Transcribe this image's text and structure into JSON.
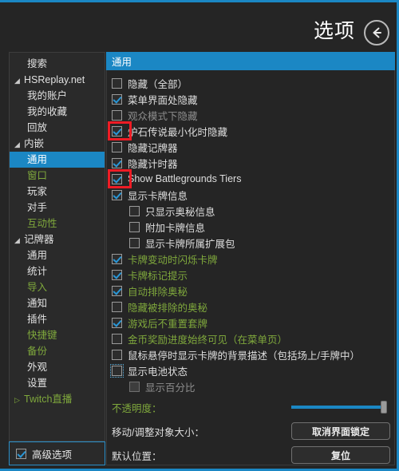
{
  "header": {
    "title": "选项",
    "back_icon": "arrow-left-icon"
  },
  "sidebar": {
    "items": [
      {
        "label": "搜索",
        "level": 1,
        "arrow": "",
        "green": false,
        "selected": false
      },
      {
        "label": "HSReplay.net",
        "level": 0,
        "arrow": "◢",
        "green": false,
        "selected": false
      },
      {
        "label": "我的账户",
        "level": 1,
        "arrow": "",
        "green": false,
        "selected": false
      },
      {
        "label": "我的收藏",
        "level": 1,
        "arrow": "",
        "green": false,
        "selected": false
      },
      {
        "label": "回放",
        "level": 1,
        "arrow": "",
        "green": false,
        "selected": false
      },
      {
        "label": "内嵌",
        "level": 0,
        "arrow": "◢",
        "green": false,
        "selected": false
      },
      {
        "label": "通用",
        "level": 1,
        "arrow": "",
        "green": false,
        "selected": true
      },
      {
        "label": "窗口",
        "level": 1,
        "arrow": "",
        "green": true,
        "selected": false
      },
      {
        "label": "玩家",
        "level": 1,
        "arrow": "",
        "green": false,
        "selected": false
      },
      {
        "label": "对手",
        "level": 1,
        "arrow": "",
        "green": false,
        "selected": false
      },
      {
        "label": "互动性",
        "level": 1,
        "arrow": "",
        "green": true,
        "selected": false
      },
      {
        "label": "记牌器",
        "level": 0,
        "arrow": "◢",
        "green": false,
        "selected": false
      },
      {
        "label": "通用",
        "level": 1,
        "arrow": "",
        "green": false,
        "selected": false
      },
      {
        "label": "统计",
        "level": 1,
        "arrow": "",
        "green": false,
        "selected": false
      },
      {
        "label": "导入",
        "level": 1,
        "arrow": "",
        "green": true,
        "selected": false
      },
      {
        "label": "通知",
        "level": 1,
        "arrow": "",
        "green": false,
        "selected": false
      },
      {
        "label": "插件",
        "level": 1,
        "arrow": "",
        "green": false,
        "selected": false
      },
      {
        "label": "快捷键",
        "level": 1,
        "arrow": "",
        "green": true,
        "selected": false
      },
      {
        "label": "备份",
        "level": 1,
        "arrow": "",
        "green": true,
        "selected": false
      },
      {
        "label": "外观",
        "level": 1,
        "arrow": "",
        "green": false,
        "selected": false
      },
      {
        "label": "设置",
        "level": 1,
        "arrow": "",
        "green": false,
        "selected": false
      },
      {
        "label": "Twitch直播",
        "level": 0,
        "arrow": "▷",
        "green": true,
        "selected": false
      }
    ],
    "advanced": {
      "label": "高级选项",
      "checked": true
    }
  },
  "main": {
    "tab_label": "通用",
    "options": [
      {
        "label": "隐藏（全部）",
        "checked": false,
        "indent": false,
        "green": false,
        "dim": false,
        "highlight": false,
        "focused": false,
        "disabled": false
      },
      {
        "label": "菜单界面处隐藏",
        "checked": true,
        "indent": false,
        "green": false,
        "dim": false,
        "highlight": false,
        "focused": false,
        "disabled": false
      },
      {
        "label": "观众模式下隐藏",
        "checked": false,
        "indent": false,
        "green": false,
        "dim": true,
        "highlight": false,
        "focused": false,
        "disabled": false
      },
      {
        "label": "炉石传说最小化时隐藏",
        "checked": true,
        "indent": false,
        "green": false,
        "dim": false,
        "highlight": true,
        "focused": false,
        "disabled": false
      },
      {
        "label": "隐藏记牌器",
        "checked": false,
        "indent": false,
        "green": false,
        "dim": false,
        "highlight": false,
        "focused": false,
        "disabled": false
      },
      {
        "label": "隐藏计时器",
        "checked": true,
        "indent": false,
        "green": false,
        "dim": false,
        "highlight": false,
        "focused": false,
        "disabled": false
      },
      {
        "label": "Show Battlegrounds Tiers",
        "checked": true,
        "indent": false,
        "green": false,
        "dim": false,
        "highlight": true,
        "focused": false,
        "disabled": false
      },
      {
        "label": "显示卡牌信息",
        "checked": true,
        "indent": false,
        "green": false,
        "dim": false,
        "highlight": false,
        "focused": false,
        "disabled": false
      },
      {
        "label": "只显示奥秘信息",
        "checked": false,
        "indent": true,
        "green": false,
        "dim": false,
        "highlight": false,
        "focused": false,
        "disabled": false
      },
      {
        "label": "附加卡牌信息",
        "checked": false,
        "indent": true,
        "green": false,
        "dim": false,
        "highlight": false,
        "focused": false,
        "disabled": false
      },
      {
        "label": "显示卡牌所属扩展包",
        "checked": false,
        "indent": true,
        "green": false,
        "dim": false,
        "highlight": false,
        "focused": false,
        "disabled": false
      },
      {
        "label": "卡牌变动时闪烁卡牌",
        "checked": true,
        "indent": false,
        "green": true,
        "dim": false,
        "highlight": false,
        "focused": false,
        "disabled": false
      },
      {
        "label": "卡牌标记提示",
        "checked": true,
        "indent": false,
        "green": true,
        "dim": false,
        "highlight": false,
        "focused": false,
        "disabled": false
      },
      {
        "label": "自动排除奥秘",
        "checked": true,
        "indent": false,
        "green": true,
        "dim": false,
        "highlight": false,
        "focused": false,
        "disabled": false
      },
      {
        "label": "隐藏被排除的奥秘",
        "checked": false,
        "indent": false,
        "green": true,
        "dim": false,
        "highlight": false,
        "focused": false,
        "disabled": false
      },
      {
        "label": "游戏后不重置套牌",
        "checked": true,
        "indent": false,
        "green": true,
        "dim": false,
        "highlight": false,
        "focused": false,
        "disabled": false
      },
      {
        "label": "金币奖励进度始终可见（在菜单页）",
        "checked": false,
        "indent": false,
        "green": true,
        "dim": false,
        "highlight": false,
        "focused": false,
        "disabled": false
      },
      {
        "label": "鼠标悬停时显示卡牌的背景描述（包括场上/手牌中）",
        "checked": false,
        "indent": false,
        "green": false,
        "dim": false,
        "highlight": false,
        "focused": false,
        "disabled": false
      },
      {
        "label": "显示电池状态",
        "checked": false,
        "indent": false,
        "green": false,
        "dim": false,
        "highlight": false,
        "focused": true,
        "disabled": false
      },
      {
        "label": "显示百分比",
        "checked": false,
        "indent": true,
        "green": false,
        "dim": true,
        "highlight": false,
        "focused": false,
        "disabled": true
      }
    ],
    "opacity": {
      "label": "不透明度：",
      "value": 100
    },
    "move_resize": {
      "label": "移动/调整对象大小：",
      "button": "取消界面锁定"
    },
    "default_position": {
      "label": "默认位置：",
      "button": "复位"
    }
  },
  "colors": {
    "accent_blue": "#1b87c4",
    "green_text": "#7fa83c",
    "highlight_red": "#ee1c25",
    "background": "#252525"
  }
}
